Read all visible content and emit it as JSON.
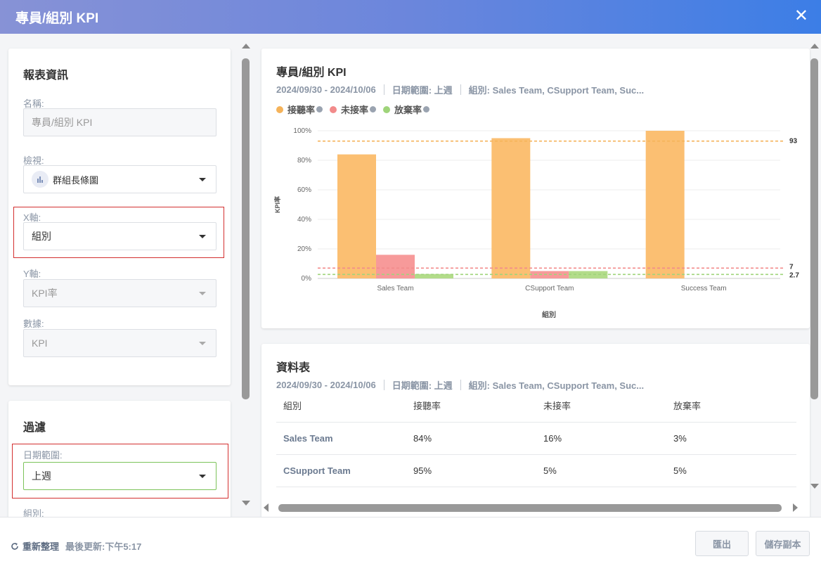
{
  "window": {
    "title": "專員/組別 KPI",
    "close_glyph": "✕"
  },
  "report_info": {
    "heading": "報表資訊",
    "name_label": "名稱:",
    "name_value": "專員/組別 KPI",
    "view_label": "檢視:",
    "view_value": "群組長條圖",
    "view_icon": "bar-chart-icon",
    "x_axis_label": "X軸:",
    "x_axis_value": "組別",
    "y_axis_label": "Y軸:",
    "y_axis_value": "KPI率",
    "data_label": "數據:",
    "data_value": "KPI"
  },
  "filter": {
    "heading": "過濾",
    "date_range_label": "日期範圍:",
    "date_range_value": "上週",
    "group_label": "組別:"
  },
  "chart_panel": {
    "title": "專員/組別 KPI",
    "date_span": "2024/09/30 - 2024/10/06",
    "date_range_text": "日期範圍: 上週",
    "group_text": "組別: Sales Team, CSupport Team, Suc..."
  },
  "chart_data": {
    "type": "bar",
    "categories": [
      "Sales Team",
      "CSupport Team",
      "Success Team"
    ],
    "series": [
      {
        "name": "接聽率",
        "values": [
          84,
          95,
          100
        ],
        "color": "#fbbf72"
      },
      {
        "name": "未接率",
        "values": [
          16,
          5,
          0
        ],
        "color": "#f79a9a"
      },
      {
        "name": "放棄率",
        "values": [
          3,
          5,
          0
        ],
        "color": "#b3dc8a"
      }
    ],
    "reference_lines": [
      {
        "label": "93",
        "value": 93,
        "color": "#f5b35a"
      },
      {
        "label": "7",
        "value": 7,
        "color": "#f28b8b"
      },
      {
        "label": "2.7",
        "value": 2.7,
        "color": "#9fd47a"
      }
    ],
    "y_ticks": [
      "0%",
      "20%",
      "40%",
      "60%",
      "80%",
      "100%"
    ],
    "ylim": [
      0,
      100
    ],
    "xlabel": "組別",
    "ylabel": "KPI率",
    "legend": "top-left",
    "grid": true
  },
  "table_panel": {
    "title": "資料表",
    "date_span": "2024/09/30 - 2024/10/06",
    "date_range_text": "日期範圍: 上週",
    "group_text": "組別: Sales Team, CSupport Team, Suc...",
    "headers": [
      "組別",
      "接聽率",
      "未接率",
      "放棄率"
    ],
    "rows": [
      [
        "Sales Team",
        "84%",
        "16%",
        "3%"
      ],
      [
        "CSupport Team",
        "95%",
        "5%",
        "5%"
      ]
    ]
  },
  "footer": {
    "refresh_label": "重新整理",
    "last_updated": "最後更新:下午5:17",
    "export_label": "匯出",
    "save_copy_label": "儲存副本"
  },
  "colors": {
    "accent_start": "#8792d6",
    "accent_end": "#3c7ee6",
    "highlight_border": "#d32f2f",
    "active_border": "#7cc35a"
  }
}
